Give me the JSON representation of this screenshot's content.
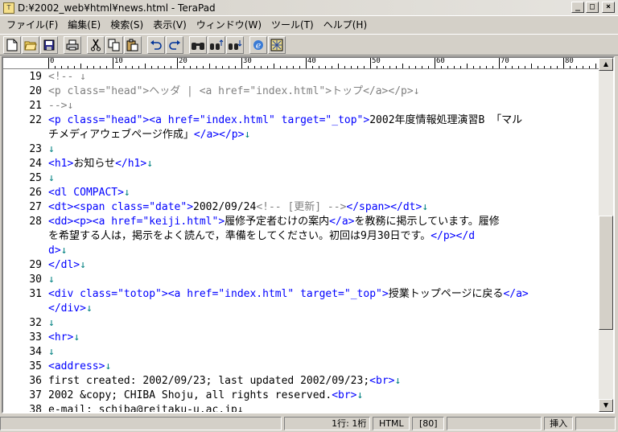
{
  "window": {
    "title": "D:¥2002_web¥html¥news.html - TeraPad",
    "app_icon": "terapad-icon",
    "controls": [
      "0",
      "1",
      "r"
    ]
  },
  "menu": [
    "ファイル(F)",
    "編集(E)",
    "検索(S)",
    "表示(V)",
    "ウィンドウ(W)",
    "ツール(T)",
    "ヘルプ(H)"
  ],
  "toolbar": {
    "buttons": [
      {
        "name": "new-file-icon",
        "glyph": "🗋"
      },
      {
        "name": "open-folder-icon",
        "glyph": "📂"
      },
      {
        "name": "save-icon",
        "glyph": "💾"
      },
      {
        "name": "print-icon",
        "glyph": "🖶"
      },
      {
        "name": "cut-icon",
        "glyph": "✂"
      },
      {
        "name": "copy-icon",
        "glyph": "⧉"
      },
      {
        "name": "paste-icon",
        "glyph": "📋"
      },
      {
        "name": "undo-icon",
        "glyph": "↶"
      },
      {
        "name": "redo-icon",
        "glyph": "↷"
      },
      {
        "name": "find-icon",
        "glyph": "🔭"
      },
      {
        "name": "find-prev-icon",
        "glyph": "⇡"
      },
      {
        "name": "find-next-icon",
        "glyph": "⇣"
      },
      {
        "name": "browser-icon",
        "glyph": "e"
      },
      {
        "name": "view-icon",
        "glyph": "▦"
      }
    ]
  },
  "ruler": {
    "labels": [
      "0",
      "10",
      "20",
      "30",
      "40",
      "50",
      "60",
      "70",
      "80"
    ]
  },
  "line_numbers": [
    "19",
    "20",
    "21",
    "22",
    "",
    "23",
    "24",
    "25",
    "26",
    "27",
    "28",
    "",
    "",
    "29",
    "30",
    "31",
    "",
    "32",
    "33",
    "34",
    "35",
    "36",
    "37",
    "38"
  ],
  "lines": [
    [
      [
        "c-cmt",
        "<!-- ↓"
      ]
    ],
    [
      [
        "c-cmt",
        "<p class=\"head\">ヘッダ | <a href=\"index.html\">トップ</a></p>↓"
      ]
    ],
    [
      [
        "c-cmt",
        "-->↓"
      ]
    ],
    [
      [
        "c-tag",
        "<p class="
      ],
      [
        "c-str",
        "\"head\""
      ],
      [
        "c-tag",
        "><a href="
      ],
      [
        "c-str",
        "\"index.html\""
      ],
      [
        "c-tag",
        " target="
      ],
      [
        "c-str",
        "\"_top\""
      ],
      [
        "c-tag",
        ">"
      ],
      [
        "c-txt",
        "2002年度情報処理演習B 「マル"
      ]
    ],
    [
      [
        "c-txt",
        "チメディアウェブページ作成」"
      ],
      [
        "c-tag",
        "</a></p>"
      ],
      [
        "c-mark",
        "↓"
      ]
    ],
    [
      [
        "c-mark",
        "↓"
      ]
    ],
    [
      [
        "c-tag",
        "<h1>"
      ],
      [
        "c-txt",
        "お知らせ"
      ],
      [
        "c-tag",
        "</h1>"
      ],
      [
        "c-mark",
        "↓"
      ]
    ],
    [
      [
        "c-mark",
        "↓"
      ]
    ],
    [
      [
        "c-tag",
        "<dl COMPACT>"
      ],
      [
        "c-mark",
        "↓"
      ]
    ],
    [
      [
        "c-tag",
        "<dt><span class="
      ],
      [
        "c-str",
        "\"date\""
      ],
      [
        "c-tag",
        ">"
      ],
      [
        "c-txt",
        "2002/09/24"
      ],
      [
        "c-cmt",
        "<!-- [更新] -->"
      ],
      [
        "c-tag",
        "</span></dt>"
      ],
      [
        "c-mark",
        "↓"
      ]
    ],
    [
      [
        "c-tag",
        "<dd><p><a href="
      ],
      [
        "c-str",
        "\"keiji.html\""
      ],
      [
        "c-tag",
        ">"
      ],
      [
        "c-txt",
        "履修予定者むけの案内"
      ],
      [
        "c-tag",
        "</a>"
      ],
      [
        "c-txt",
        "を教務に掲示しています。履修"
      ]
    ],
    [
      [
        "c-txt",
        "を希望する人は，掲示をよく読んで，準備をしてください。初回は9月30日です。"
      ],
      [
        "c-tag",
        "</p></d"
      ]
    ],
    [
      [
        "c-tag",
        "d>"
      ],
      [
        "c-mark",
        "↓"
      ]
    ],
    [
      [
        "c-tag",
        "</dl>"
      ],
      [
        "c-mark",
        "↓"
      ]
    ],
    [
      [
        "c-mark",
        "↓"
      ]
    ],
    [
      [
        "c-tag",
        "<div class="
      ],
      [
        "c-str",
        "\"totop\""
      ],
      [
        "c-tag",
        "><a href="
      ],
      [
        "c-str",
        "\"index.html\""
      ],
      [
        "c-tag",
        " target="
      ],
      [
        "c-str",
        "\"_top\""
      ],
      [
        "c-tag",
        ">"
      ],
      [
        "c-txt",
        "授業トップページに戻る"
      ],
      [
        "c-tag",
        "</a>"
      ]
    ],
    [
      [
        "c-tag",
        "</div>"
      ],
      [
        "c-mark",
        "↓"
      ]
    ],
    [
      [
        "c-mark",
        "↓"
      ]
    ],
    [
      [
        "c-tag",
        "<hr>"
      ],
      [
        "c-mark",
        "↓"
      ]
    ],
    [
      [
        "c-mark",
        "↓"
      ]
    ],
    [
      [
        "c-tag",
        "<address>"
      ],
      [
        "c-mark",
        "↓"
      ]
    ],
    [
      [
        "c-txt",
        "first created: 2002/09/23; last updated 2002/09/23;"
      ],
      [
        "c-tag",
        "<br>"
      ],
      [
        "c-mark",
        "↓"
      ]
    ],
    [
      [
        "c-txt",
        "2002 &copy; CHIBA Shoju, all rights reserved."
      ],
      [
        "c-tag",
        "<br>"
      ],
      [
        "c-mark",
        "↓"
      ]
    ],
    [
      [
        "c-txt",
        "e-mail: schiba@reitaku-u.ac.jp↓"
      ]
    ]
  ],
  "status": {
    "position": "1行:   1桁",
    "mode": "HTML",
    "width": "[80]",
    "insert": "挿入"
  }
}
